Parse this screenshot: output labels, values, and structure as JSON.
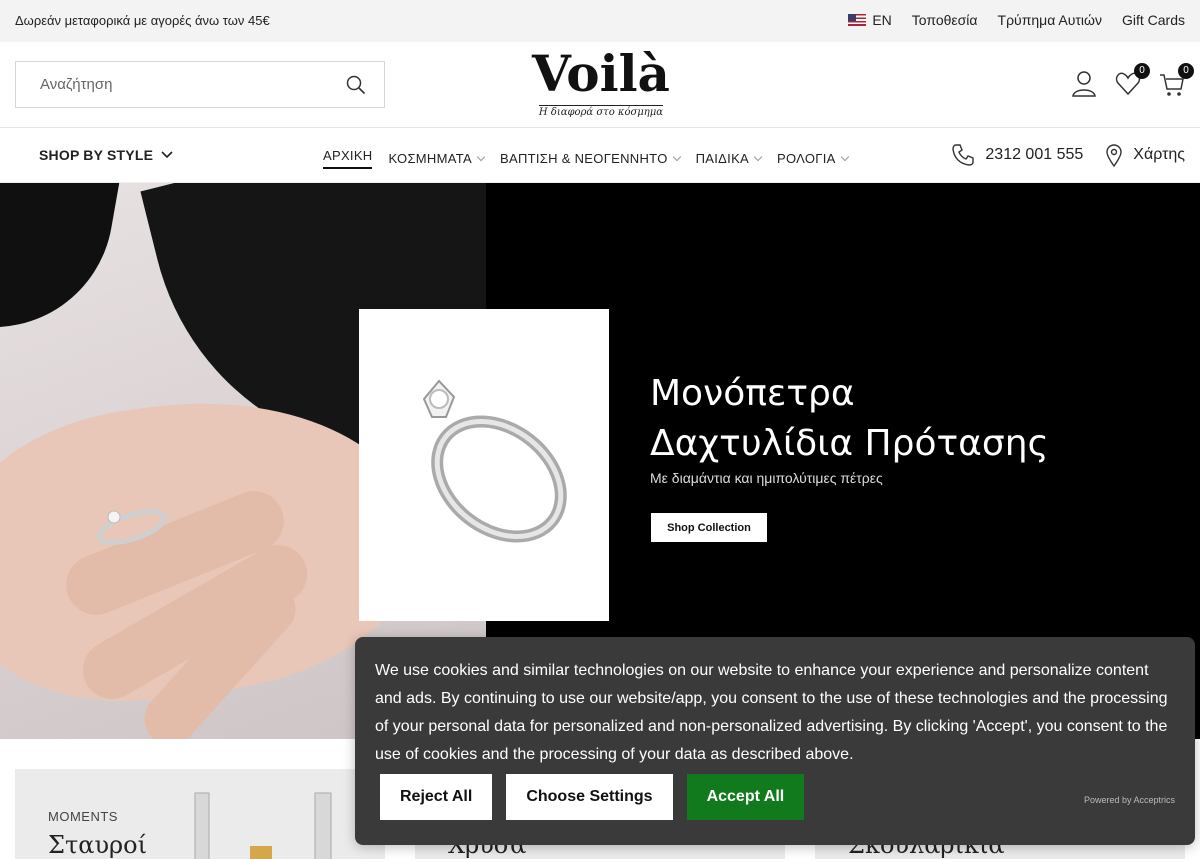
{
  "topbar": {
    "promo": "Δωρεάν μεταφορικά με αγορές άνω των 45€",
    "language": "EN",
    "links": [
      "Τοποθεσία",
      "Τρύπημα Αυτιών",
      "Gift Cards"
    ]
  },
  "header": {
    "search_placeholder": "Αναζήτηση",
    "logo_name": "Voilà",
    "logo_tagline": "Η διαφορά στο κόσμημα",
    "wishlist_count": "0",
    "cart_count": "0"
  },
  "nav": {
    "shop_by_style": "SHOP BY STYLE",
    "items": [
      {
        "label": "ΑΡΧΙΚΗ",
        "active": true
      },
      {
        "label": "ΚΟΣΜΗΜΑΤΑ",
        "dropdown": true
      },
      {
        "label": "ΒΑΠΤΙΣΗ & ΝΕΟΓΕΝΝΗΤΟ",
        "dropdown": true
      },
      {
        "label": "ΠΑΙΔΙΚΑ",
        "dropdown": true
      },
      {
        "label": "ΡΟΛΟΓΙΑ",
        "dropdown": true
      }
    ],
    "phone": "2312 001 555",
    "map": "Χάρτης"
  },
  "hero": {
    "title_line1": "Μονόπετρα",
    "title_line2": "Δαχτυλίδια Πρότασης",
    "subtitle": "Με διαμάντια και ημιπολύτιμες πέτρες",
    "cta": "Shop Collection"
  },
  "cards": [
    {
      "kicker": "MOMENTS",
      "title": "Σταυροί"
    },
    {
      "kicker": "",
      "title": "Χρυσά"
    },
    {
      "kicker": "",
      "title": "Σκουλαρίκια"
    }
  ],
  "cookie": {
    "text": "We use cookies and similar technologies on our website to enhance your experience and personalize content and ads. By continuing to use our website/app, you consent to the use of these technologies and the processing of your personal data for personalized and non-personalized advertising. By clicking 'Accept', you consent to the use of cookies and the processing of your data as described above.",
    "reject": "Reject All",
    "choose": "Choose Settings",
    "accept": "Accept All",
    "powered": "Powered by Acceptrics"
  },
  "colors": {
    "accept_green": "#117a1d",
    "cookie_bg": "#3a3a3a",
    "topbar_bg": "#f3f3f3"
  }
}
